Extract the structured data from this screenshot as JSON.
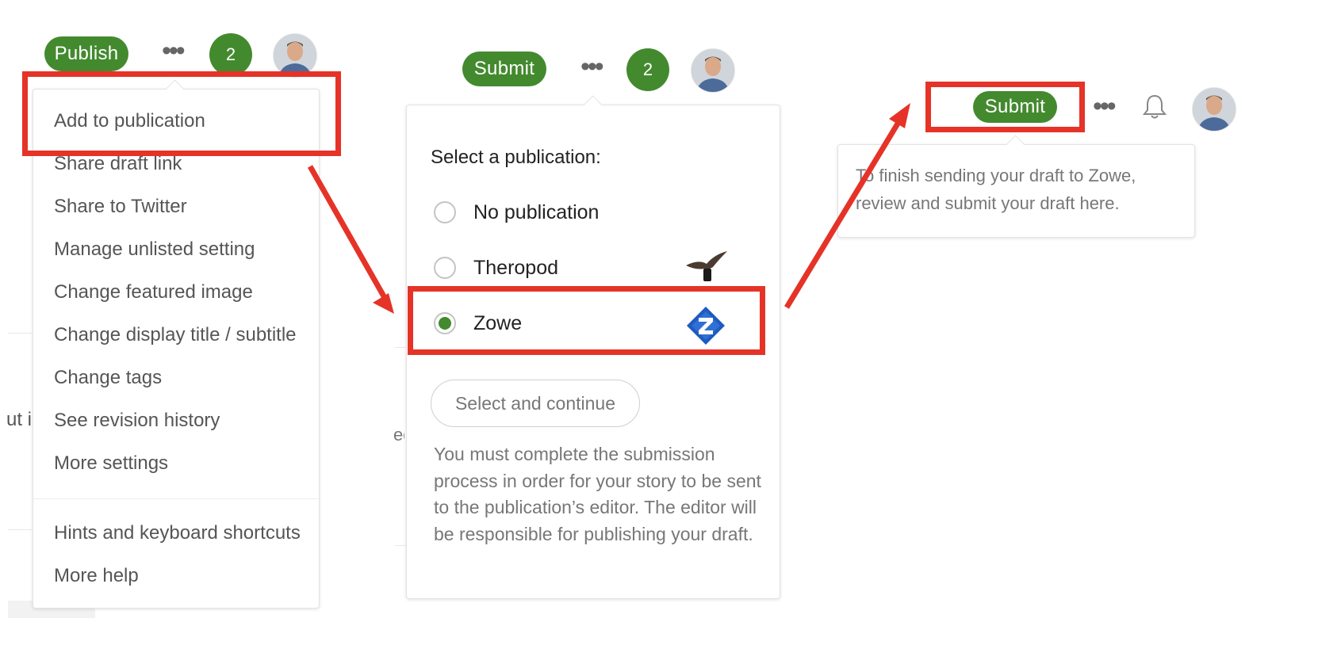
{
  "colors": {
    "accent_green": "#438a2e",
    "highlight_red": "#e53328"
  },
  "panel1": {
    "publish_label": "Publish",
    "more_icon": "more-horizontal-icon",
    "notification_count": "2",
    "avatar_icon": "user-avatar-icon",
    "menu_items": [
      "Add to publication",
      "Share draft link",
      "Share to Twitter",
      "Manage unlisted setting",
      "Change featured image",
      "Change display title / subtitle",
      "Change tags",
      "See revision history",
      "More settings"
    ],
    "help_items": [
      "Hints and keyboard shortcuts",
      "More help"
    ],
    "background_fragment": "ut i"
  },
  "panel2": {
    "submit_label": "Submit",
    "notification_count": "2",
    "heading": "Select a publication:",
    "options": [
      {
        "label": "No publication",
        "selected": false
      },
      {
        "label": "Theropod",
        "selected": false,
        "logo": "bird-logo-icon"
      },
      {
        "label": "Zowe",
        "selected": true,
        "logo": "zowe-logo-icon"
      }
    ],
    "select_button": "Select and continue",
    "note": "You must complete the submission process in order for your story to be sent to the publication’s editor. The editor will be responsible for publishing your draft.",
    "background_fragment": "ed"
  },
  "panel3": {
    "submit_label": "Submit",
    "bell_icon": "bell-icon",
    "tooltip_line1": "To finish sending your draft to Zowe,",
    "tooltip_line2": "review and submit your draft here."
  }
}
